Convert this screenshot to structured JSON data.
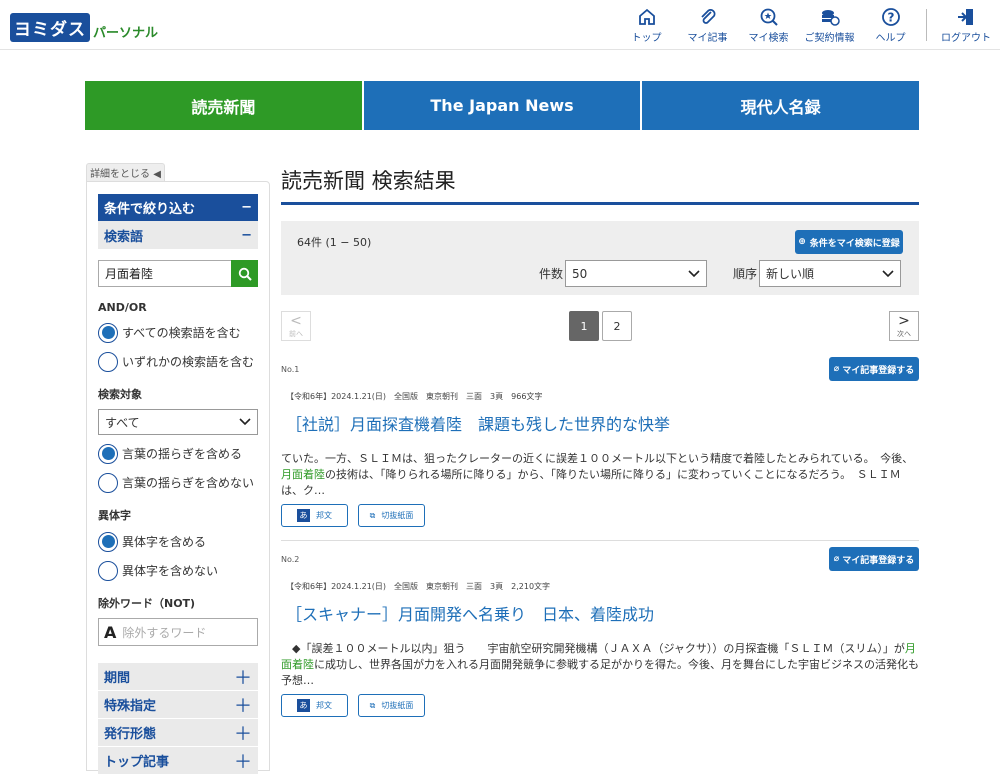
{
  "logo": {
    "main": "ヨミダス",
    "sub": "パーソナル"
  },
  "nav": {
    "items": [
      "トップ",
      "マイ記事",
      "マイ検索",
      "ご契約情報",
      "ヘルプ"
    ],
    "logout": "ログアウト"
  },
  "tabs": [
    "読売新聞",
    "The Japan News",
    "現代人名録"
  ],
  "sidebar": {
    "collapse": "詳細をとじる ◀",
    "filter_title": "条件で絞り込む",
    "keyword_title": "検索語",
    "minus": "−",
    "keyword_value": "月面着陸",
    "andor_label": "AND/OR",
    "andor_opts": [
      "すべての検索語を含む",
      "いずれかの検索語を含む"
    ],
    "target_label": "検索対象",
    "target_value": "すべて",
    "fuzzy_opts": [
      "言葉の揺らぎを含める",
      "言葉の揺らぎを含めない"
    ],
    "variant_label": "異体字",
    "variant_opts": [
      "異体字を含める",
      "異体字を含めない"
    ],
    "not_label": "除外ワード（NOT)",
    "not_placeholder": "除外するワード",
    "accordions": [
      "期間",
      "特殊指定",
      "発行形態",
      "トップ記事"
    ],
    "plus": "＋"
  },
  "main": {
    "title": "読売新聞 検索結果",
    "count": "64件 (1 − 50)",
    "register_search": "条件をマイ検索に登録",
    "per_page_label": "件数",
    "per_page_value": "50",
    "order_label": "順序",
    "order_value": "新しい順",
    "prev": "前へ",
    "next": "次へ",
    "pages": [
      "1",
      "2"
    ]
  },
  "results": [
    {
      "no": "No.1",
      "my": "マイ記事登録する",
      "meta": "【令和6年】2024.1.21(日)　全国版　東京朝刊　三面　3頁　966文字",
      "headline": "［社説］月面探査機着陸　課題も残した世界的な快挙",
      "body_pre": "ていた。一方、ＳＬＩＭは、狙ったクレーターの近くに誤差１００メートル以下という精度で着陸したとみられている。　今後、",
      "body_hit": "月面着陸",
      "body_post": "の技術は、「降りられる場所に降りる」から、「降りたい場所に降りる」に変わっていくことになるだろう。　ＳＬＩＭは、ク…",
      "btn1": "邦文",
      "btn2": "切抜紙面"
    },
    {
      "no": "No.2",
      "my": "マイ記事登録する",
      "meta": "【令和6年】2024.1.21(日)　全国版　東京朝刊　三面　3頁　2,210文字",
      "headline": "［スキャナー］月面開発へ名乗り　日本、着陸成功",
      "body_pre": "　◆「誤差１００メートル以内」狙う　　宇宙航空研究開発機構（ＪＡＸＡ（ジャクサ））の月探査機「ＳＬＩＭ（スリム）」が",
      "body_hit": "月面着陸",
      "body_post": "に成功し、世界各国が力を入れる月面開発競争に参戦する足がかりを得た。今後、月を舞台にした宇宙ビジネスの活発化も予想…",
      "btn1": "邦文",
      "btn2": "切抜紙面"
    }
  ]
}
